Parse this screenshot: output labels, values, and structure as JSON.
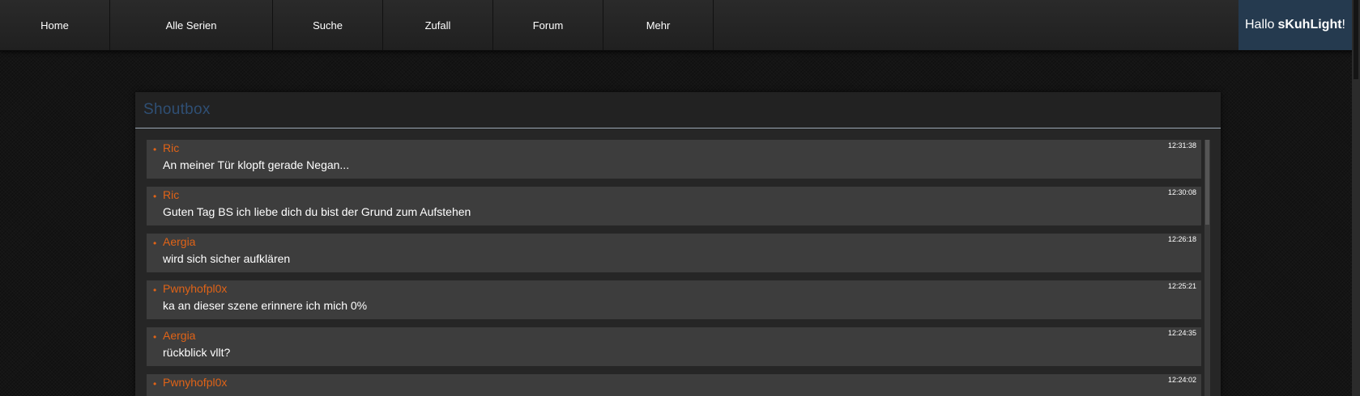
{
  "nav": {
    "items": [
      {
        "label": "Home"
      },
      {
        "label": "Alle Serien"
      },
      {
        "label": "Suche"
      },
      {
        "label": "Zufall"
      },
      {
        "label": "Forum"
      },
      {
        "label": "Mehr"
      }
    ],
    "greeting_prefix": "Hallo",
    "username": "sKuhLight",
    "greeting_suffix": "!"
  },
  "shoutbox": {
    "title": "Shoutbox",
    "bullet": "•",
    "shouts": [
      {
        "author": "Ric",
        "message": "An meiner Tür klopft gerade Negan...",
        "time": "12:31:38"
      },
      {
        "author": "Ric",
        "message": "Guten Tag BS ich liebe dich du bist der Grund zum Aufstehen",
        "time": "12:30:08"
      },
      {
        "author": "Aergia",
        "message": "wird sich sicher aufklären",
        "time": "12:26:18"
      },
      {
        "author": "Pwnyhofpl0x",
        "message": "ka an dieser szene erinnere ich mich 0%",
        "time": "12:25:21"
      },
      {
        "author": "Aergia",
        "message": "rückblick vllt?",
        "time": "12:24:35"
      },
      {
        "author": "Pwnyhofpl0x",
        "message": "",
        "time": "12:24:02"
      }
    ]
  },
  "colors": {
    "accent": "#e06317",
    "greeting_bg": "#253a4f",
    "title": "#2f4f74"
  }
}
